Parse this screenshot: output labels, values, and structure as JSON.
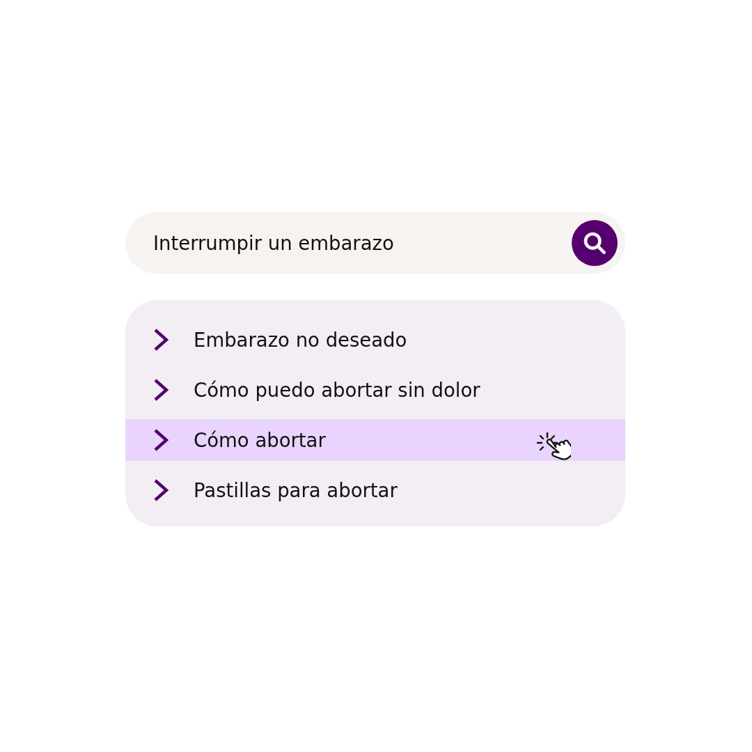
{
  "search": {
    "value": "Interrumpir un embarazo"
  },
  "suggestions": [
    {
      "label": "Embarazo no deseado",
      "selected": false
    },
    {
      "label": "Cómo puedo abortar sin dolor",
      "selected": false
    },
    {
      "label": "Cómo abortar",
      "selected": true
    },
    {
      "label": "Pastillas para abortar",
      "selected": false
    }
  ]
}
